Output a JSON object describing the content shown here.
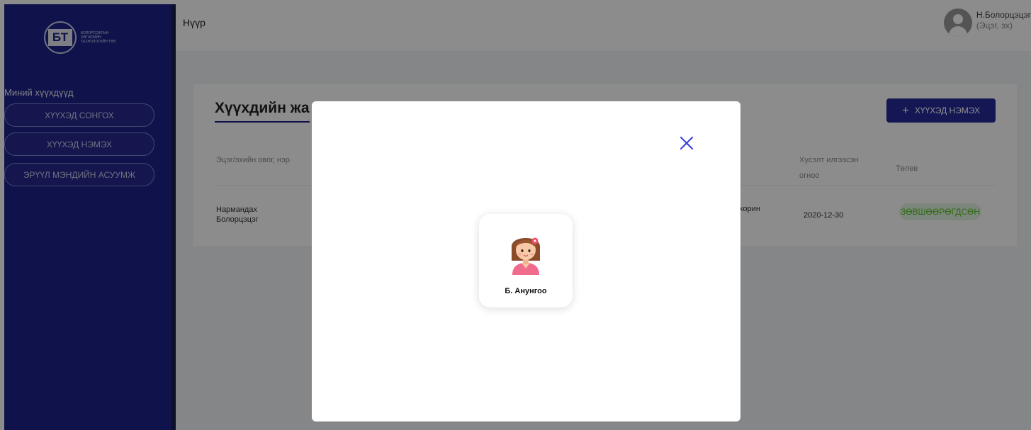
{
  "sidebar": {
    "logo_text": "БОЛОРСОФТЫН ХӨГЖЛИЙН ТЕХНОЛОГИЙН ТӨВ",
    "heading": "Миний хүүхдүүд",
    "items": [
      {
        "label": "Хүүхэд сонгох"
      },
      {
        "label": "Хүүхэд нэмэх"
      },
      {
        "label": "Эрүүл мэндийн асуумж"
      }
    ]
  },
  "topbar": {
    "breadcrumb": "Нүүр",
    "user_name": "Н.Болорцэцэг",
    "user_role": "(Эцэг, эх)"
  },
  "main": {
    "title": "Хүүхдийн жа",
    "add_button": {
      "icon": "+",
      "label": "Хүүхэд нэмэх"
    },
    "table": {
      "headers": [
        "Эцэг/эхийн овог, нэр",
        "Хүсэлт илгээсэн огноо",
        "Төлөв"
      ],
      "rows": [
        {
          "parent": "Нармандах Болорцэцэг",
          "partial": "хорин",
          "date": "2020-12-30",
          "status": "Зөвшөөрөгдсөн"
        }
      ]
    },
    "colors": {
      "accent": "#262a9a",
      "status": "#52c41a"
    }
  },
  "modal": {
    "close_icon": "close-icon",
    "children": [
      {
        "name": "Б. Анунгоо",
        "avatar": "girl-avatar-icon"
      }
    ]
  }
}
